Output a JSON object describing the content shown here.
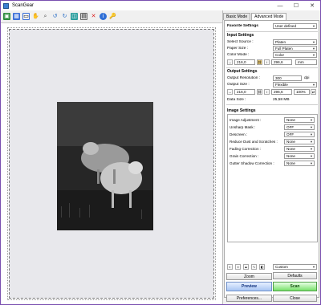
{
  "window": {
    "title": "ScanGear",
    "controls": {
      "minimize": "—",
      "maximize": "☐",
      "close": "✕"
    }
  },
  "toolbar": {
    "icons": [
      "scan-icon",
      "select-icon",
      "crop-icon",
      "hand-icon",
      "zoom-icon",
      "rotate-left-icon",
      "rotate-right-icon",
      "auto-crop-icon",
      "multi-crop-icon",
      "delete-icon",
      "info-icon",
      "preferences-icon"
    ]
  },
  "tabs": {
    "basic": "Basic Mode",
    "advanced": "Advanced Mode"
  },
  "favorite": {
    "label": "Favorite Settings",
    "value": "User defined"
  },
  "input": {
    "title": "Input Settings",
    "select_source_label": "Select Source :",
    "select_source_value": "Platen",
    "paper_size_label": "Paper Size :",
    "paper_size_value": "Full Platen",
    "color_mode_label": "Color Mode :",
    "color_mode_value": "Color",
    "width": "216,0",
    "height": "296,6",
    "unit": "mm"
  },
  "output": {
    "title": "Output Settings",
    "resolution_label": "Output Resolution :",
    "resolution_value": "300",
    "resolution_unit": "dpi",
    "size_label": "Output Size :",
    "size_value": "Flexible",
    "width": "216,0",
    "height": "296,6",
    "scale": "100%",
    "data_size_label": "Data Size :",
    "data_size_value": "25,58 MB"
  },
  "image_settings": {
    "title": "Image Settings",
    "rows": [
      {
        "label": "Image Adjustment :",
        "value": "None"
      },
      {
        "label": "Unsharp Mask :",
        "value": "OFF"
      },
      {
        "label": "Descreen :",
        "value": "OFF"
      },
      {
        "label": "Reduce Dust and Scratches :",
        "value": "None"
      },
      {
        "label": "Fading Correction :",
        "value": "None"
      },
      {
        "label": "Grain Correction :",
        "value": "None"
      },
      {
        "label": "Gutter Shadow Correction :",
        "value": "None"
      }
    ]
  },
  "tone": {
    "preset": "Custom",
    "defaults_label": "Defaults"
  },
  "actions": {
    "zoom": "Zoom",
    "preview": "Preview",
    "scan": "Scan",
    "preferences": "Preferences...",
    "close": "Close"
  }
}
